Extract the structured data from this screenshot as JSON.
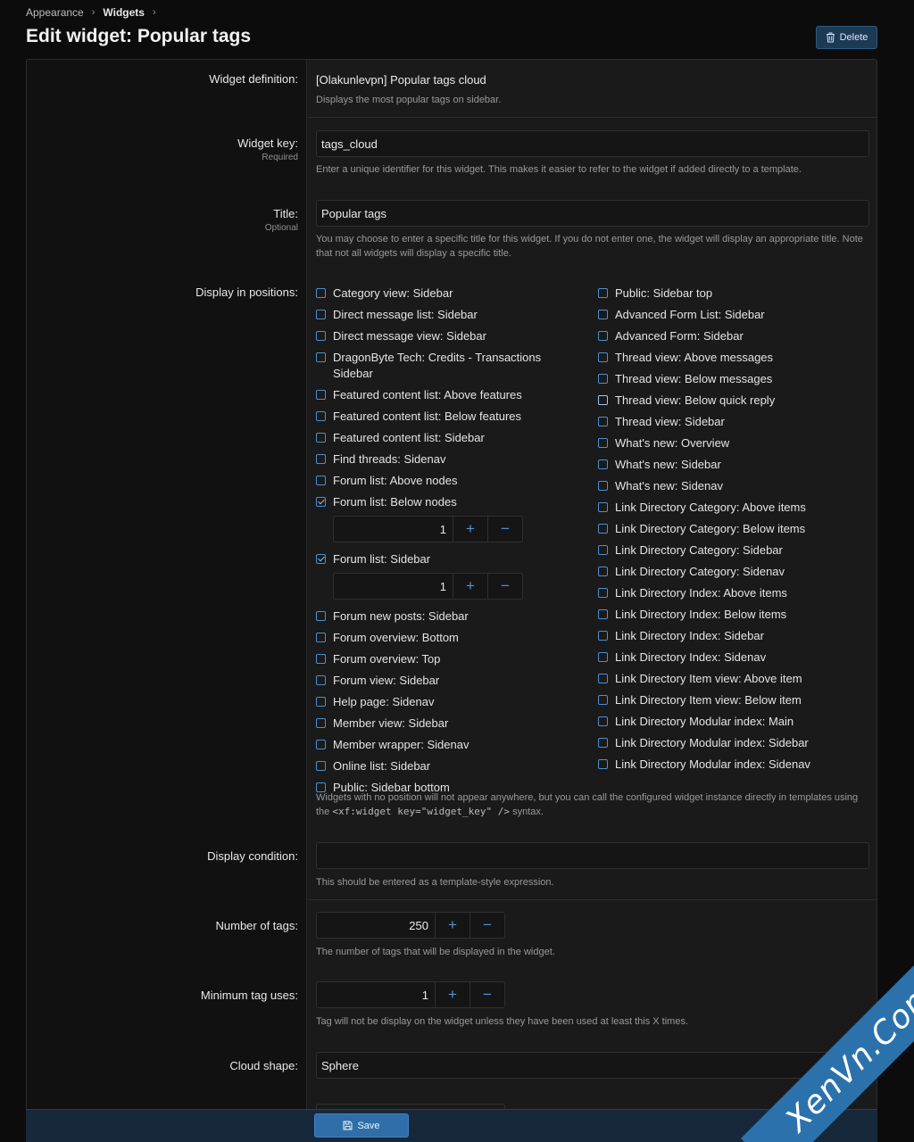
{
  "breadcrumb": {
    "items": [
      "Appearance",
      "Widgets"
    ],
    "separator": "›"
  },
  "page": {
    "title": "Edit widget: Popular tags",
    "delete_label": "Delete"
  },
  "form": {
    "definition": {
      "label": "Widget definition:",
      "value": "[Olakunlevpn] Popular tags cloud",
      "hint": "Displays the most popular tags on sidebar."
    },
    "key": {
      "label": "Widget key:",
      "sublabel": "Required",
      "value": "tags_cloud",
      "hint": "Enter a unique identifier for this widget. This makes it easier to refer to the widget if added directly to a template."
    },
    "title": {
      "label": "Title:",
      "sublabel": "Optional",
      "value": "Popular tags",
      "hint": "You may choose to enter a specific title for this widget. If you do not enter one, the widget will display an appropriate title. Note that not all widgets will display a specific title."
    },
    "positions": {
      "label": "Display in positions:",
      "left": [
        {
          "label": "Category view: Sidebar",
          "checked": false
        },
        {
          "label": "Direct message list: Sidebar",
          "checked": false
        },
        {
          "label": "Direct message view: Sidebar",
          "checked": false
        },
        {
          "label": "DragonByte Tech: Credits - Transactions",
          "label2": "Sidebar",
          "checked": false
        },
        {
          "label": "Featured content list: Above features",
          "checked": false
        },
        {
          "label": "Featured content list: Below features",
          "checked": false
        },
        {
          "label": "Featured content list: Sidebar",
          "checked": false
        },
        {
          "label": "Find threads: Sidenav",
          "checked": false
        },
        {
          "label": "Forum list: Above nodes",
          "checked": false
        },
        {
          "label": "Forum list: Below nodes",
          "checked": true,
          "order": "1"
        },
        {
          "label": "Forum list: Sidebar",
          "checked": true,
          "order": "1"
        },
        {
          "label": "Forum new posts: Sidebar",
          "checked": false
        },
        {
          "label": "Forum overview: Bottom",
          "checked": false
        },
        {
          "label": "Forum overview: Top",
          "checked": false
        },
        {
          "label": "Forum view: Sidebar",
          "checked": false
        },
        {
          "label": "Help page: Sidenav",
          "checked": false
        },
        {
          "label": "Member view: Sidebar",
          "checked": false
        },
        {
          "label": "Member wrapper: Sidenav",
          "checked": false
        },
        {
          "label": "Online list: Sidebar",
          "checked": false
        },
        {
          "label": "Public: Sidebar bottom",
          "checked": false
        }
      ],
      "right": [
        {
          "label": "Public: Sidebar top",
          "checked": false
        },
        {
          "label": "Advanced Form List: Sidebar",
          "checked": false
        },
        {
          "label": "Advanced Form: Sidebar",
          "checked": false
        },
        {
          "label": "Thread view: Above messages",
          "checked": false
        },
        {
          "label": "Thread view: Below messages",
          "checked": false
        },
        {
          "label": "Thread view: Below quick reply",
          "checked": false
        },
        {
          "label": "Thread view: Sidebar",
          "checked": false
        },
        {
          "label": "What's new: Overview",
          "checked": false
        },
        {
          "label": "What's new: Sidebar",
          "checked": false
        },
        {
          "label": "What's new: Sidenav",
          "checked": false
        },
        {
          "label": "Link Directory Category: Above items",
          "checked": false
        },
        {
          "label": "Link Directory Category: Below items",
          "checked": false
        },
        {
          "label": "Link Directory Category: Sidebar",
          "checked": false
        },
        {
          "label": "Link Directory Category: Sidenav",
          "checked": false
        },
        {
          "label": "Link Directory Index: Above items",
          "checked": false
        },
        {
          "label": "Link Directory Index: Below items",
          "checked": false
        },
        {
          "label": "Link Directory Index: Sidebar",
          "checked": false
        },
        {
          "label": "Link Directory Index: Sidenav",
          "checked": false
        },
        {
          "label": "Link Directory Item view: Above item",
          "checked": false
        },
        {
          "label": "Link Directory Item view: Below item",
          "checked": false
        },
        {
          "label": "Link Directory Modular index: Main",
          "checked": false
        },
        {
          "label": "Link Directory Modular index: Sidebar",
          "checked": false
        },
        {
          "label": "Link Directory Modular index: Sidenav",
          "checked": false
        }
      ],
      "hint_before": "Widgets with no position will not appear anywhere, but you can call the configured widget instance directly in templates using the ",
      "hint_code": "<xf:widget key=\"widget_key\" />",
      "hint_after": " syntax."
    },
    "condition": {
      "label": "Display condition:",
      "value": "",
      "hint": "This should be entered as a template-style expression."
    },
    "num_tags": {
      "label": "Number of tags:",
      "value": "250",
      "hint": "The number of tags that will be displayed in the widget."
    },
    "min_uses": {
      "label": "Minimum tag uses:",
      "value": "1",
      "hint": "Tag will not be display on the widget unless they have been used at least this X times."
    },
    "shape": {
      "label": "Cloud shape:",
      "value": "Sphere"
    }
  },
  "stepper": {
    "plus": "+",
    "minus": "−"
  },
  "footer": {
    "save_label": "Save"
  },
  "watermark": {
    "text": "XenVn.Com"
  },
  "colors": {
    "accent": "#4a94da",
    "save": "#2f6ea8",
    "delete": "#1d3a55"
  }
}
